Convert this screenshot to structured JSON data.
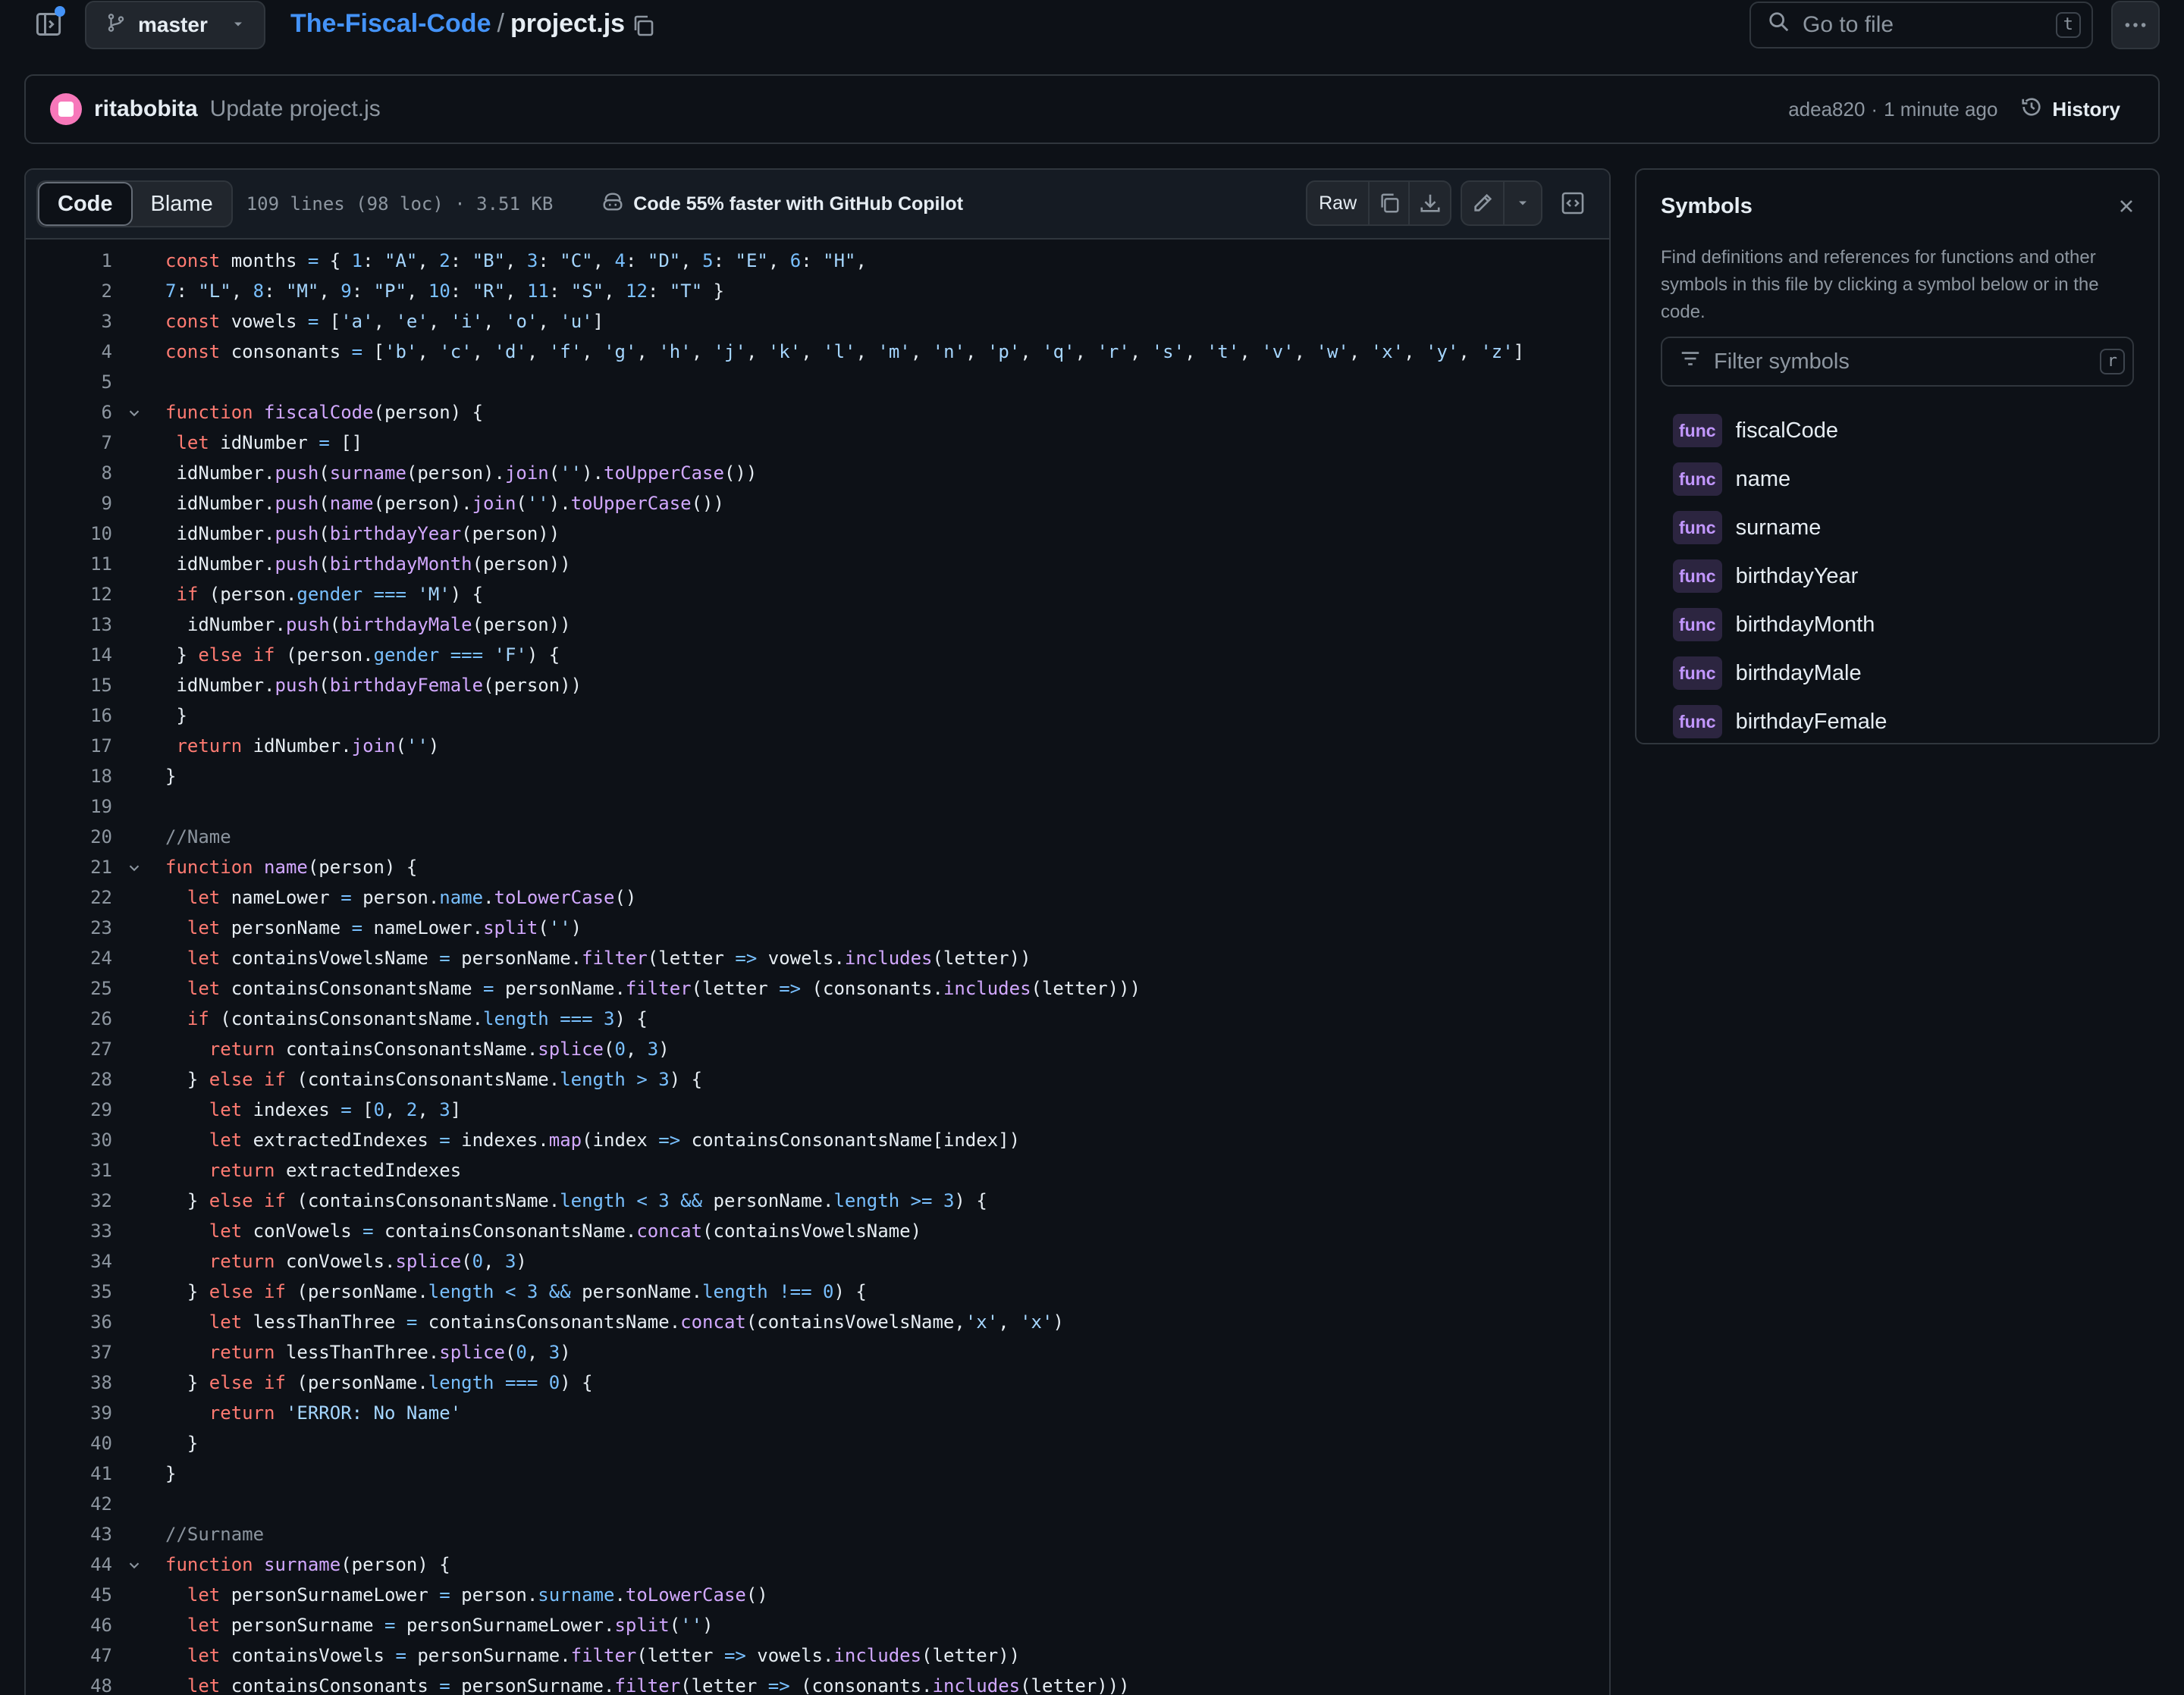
{
  "header": {
    "branch": "master",
    "repo": "The-Fiscal-Code",
    "separator": "/",
    "file": "project.js",
    "goto_placeholder": "Go to file",
    "goto_key": "t"
  },
  "commit": {
    "author": "ritabobita",
    "message": "Update project.js",
    "sha": "adea820",
    "dot": "·",
    "time": "1 minute ago",
    "history_label": "History"
  },
  "toolbar": {
    "tab_code": "Code",
    "tab_blame": "Blame",
    "file_info": "109 lines (98 loc) · 3.51 KB",
    "copilot": "Code 55% faster with GitHub Copilot",
    "raw": "Raw"
  },
  "code_lines": [
    "const months = { 1: \"A\", 2: \"B\", 3: \"C\", 4: \"D\", 5: \"E\", 6: \"H\",",
    "7: \"L\", 8: \"M\", 9: \"P\", 10: \"R\", 11: \"S\", 12: \"T\" }",
    "const vowels = ['a', 'e', 'i', 'o', 'u']",
    "const consonants = ['b', 'c', 'd', 'f', 'g', 'h', 'j', 'k', 'l', 'm', 'n', 'p', 'q', 'r', 's', 't', 'v', 'w', 'x', 'y', 'z']",
    "",
    "function fiscalCode(person) {",
    " let idNumber = []",
    " idNumber.push(surname(person).join('').toUpperCase())",
    " idNumber.push(name(person).join('').toUpperCase())",
    " idNumber.push(birthdayYear(person))",
    " idNumber.push(birthdayMonth(person))",
    " if (person.gender === 'M') {",
    "  idNumber.push(birthdayMale(person))",
    " } else if (person.gender === 'F') {",
    " idNumber.push(birthdayFemale(person))",
    " }",
    " return idNumber.join('')",
    "}",
    "",
    "//Name",
    "function name(person) {",
    "  let nameLower = person.name.toLowerCase()",
    "  let personName = nameLower.split('')",
    "  let containsVowelsName = personName.filter(letter => vowels.includes(letter))",
    "  let containsConsonantsName = personName.filter(letter => (consonants.includes(letter)))",
    "  if (containsConsonantsName.length === 3) {",
    "    return containsConsonantsName.splice(0, 3)",
    "  } else if (containsConsonantsName.length > 3) {",
    "    let indexes = [0, 2, 3]",
    "    let extractedIndexes = indexes.map(index => containsConsonantsName[index])",
    "    return extractedIndexes",
    "  } else if (containsConsonantsName.length < 3 && personName.length >= 3) {",
    "    let conVowels = containsConsonantsName.concat(containsVowelsName)",
    "    return conVowels.splice(0, 3)",
    "  } else if (personName.length < 3 && personName.length !== 0) {",
    "    let lessThanThree = containsConsonantsName.concat(containsVowelsName,'x', 'x')",
    "    return lessThanThree.splice(0, 3)",
    "  } else if (personName.length === 0) {",
    "    return 'ERROR: No Name'",
    "  }",
    "}",
    "",
    "//Surname",
    "function surname(person) {",
    "  let personSurnameLower = person.surname.toLowerCase()",
    "  let personSurname = personSurnameLower.split('')",
    "  let containsVowels = personSurname.filter(letter => vowels.includes(letter))",
    "  let containsConsonants = personSurname.filter(letter => (consonants.includes(letter)))"
  ],
  "folded_lines": [
    6,
    21,
    44
  ],
  "symbols": {
    "title": "Symbols",
    "description": "Find definitions and references for functions and other symbols in this file by clicking a symbol below or in the code.",
    "filter_placeholder": "Filter symbols",
    "filter_key": "r",
    "items": [
      {
        "kind": "func",
        "name": "fiscalCode"
      },
      {
        "kind": "func",
        "name": "name"
      },
      {
        "kind": "func",
        "name": "surname"
      },
      {
        "kind": "func",
        "name": "birthdayYear"
      },
      {
        "kind": "func",
        "name": "birthdayMonth"
      },
      {
        "kind": "func",
        "name": "birthdayMale"
      },
      {
        "kind": "func",
        "name": "birthdayFemale"
      }
    ]
  },
  "icons": {
    "sidebar_toggle": "sidebar-expand-icon",
    "branch": "git-branch-icon",
    "copy_path": "copy-icon",
    "search": "search-icon",
    "more": "kebab-horizontal-icon",
    "history": "history-icon",
    "copilot": "copilot-icon",
    "copy_raw": "copy-icon",
    "download": "download-icon",
    "edit": "pencil-icon",
    "symbols_panel": "code-square-icon",
    "close": "x-icon",
    "filter": "filter-icon"
  },
  "colors": {
    "background": "#0d1117",
    "accent": "#4493f8",
    "keyword": "#ff7b72",
    "function": "#d2a8ff",
    "string": "#a5d6ff",
    "number": "#79c0ff",
    "comment": "#8b949e",
    "badge": "#c297ff"
  }
}
